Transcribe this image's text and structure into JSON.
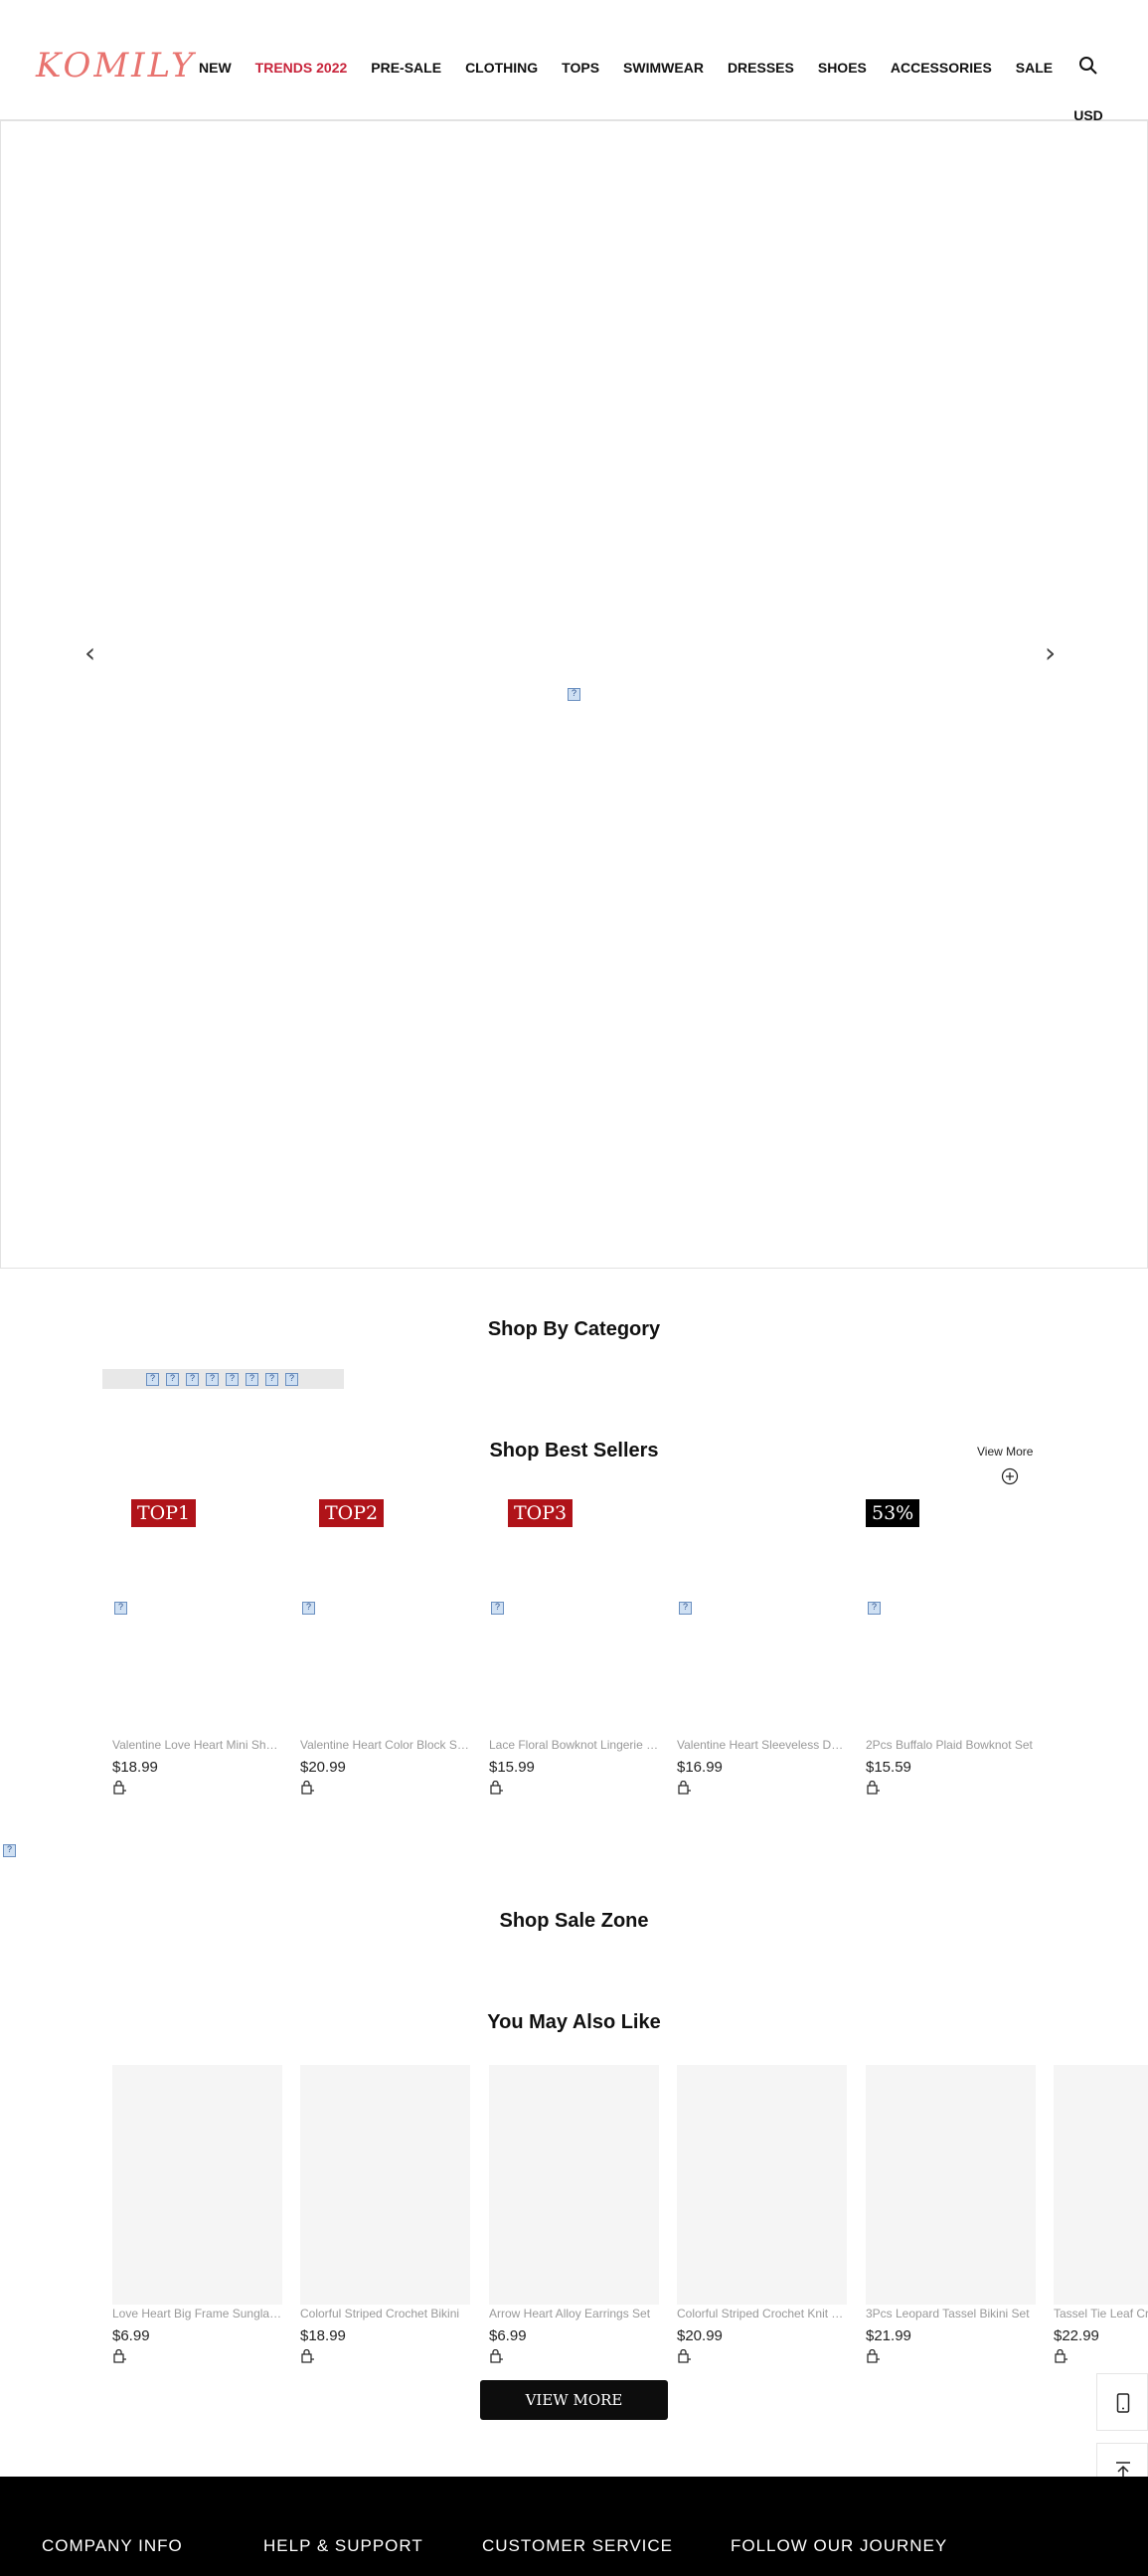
{
  "header": {
    "logo": "KOMILY",
    "nav": [
      "NEW",
      "TRENDS 2022",
      "PRE-SALE",
      "CLOTHING",
      "TOPS",
      "SWIMWEAR",
      "DRESSES",
      "SHOES",
      "ACCESSORIES",
      "SALE"
    ],
    "currency": "USD",
    "icons": [
      "search-icon",
      "headset-icon",
      "account-icon",
      "gift-icon",
      "bag-icon"
    ]
  },
  "sections": {
    "shop_by_category": "Shop By Category",
    "best_sellers": "Shop Best Sellers",
    "view_more_link": "View More",
    "sale_zone": "Shop Sale Zone",
    "you_may_also_like": "You May Also Like",
    "view_more_button": "VIEW MORE"
  },
  "best_sellers": [
    {
      "badge": "TOP1",
      "name": "Valentine Love Heart Mini Shoulder Bag",
      "price": "$18.99"
    },
    {
      "badge": "TOP2",
      "name": "Valentine Heart Color Block Sweater",
      "price": "$20.99"
    },
    {
      "badge": "TOP3",
      "name": "Lace Floral Bowknot Lingerie Set",
      "price": "$15.99"
    },
    {
      "badge": "",
      "name": "Valentine Heart Sleeveless Dress",
      "price": "$16.99"
    },
    {
      "badge": "53%",
      "name": "2Pcs Buffalo Plaid Bowknot Set",
      "price": "$15.59"
    }
  ],
  "you_may_also_like": [
    {
      "name": "Love Heart Big Frame Sunglasses",
      "price": "$6.99"
    },
    {
      "name": "Colorful Striped Crochet Bikini",
      "price": "$18.99"
    },
    {
      "name": "Arrow Heart Alloy Earrings Set",
      "price": "$6.99"
    },
    {
      "name": "Colorful Striped Crochet Knit Top",
      "price": "$20.99"
    },
    {
      "name": "3Pcs Leopard Tassel Bikini Set",
      "price": "$21.99"
    },
    {
      "name": "Tassel Tie Leaf Crop Top",
      "price": "$22.99"
    }
  ],
  "footer": {
    "columns": [
      "COMPANY INFO",
      "HELP & SUPPORT",
      "CUSTOMER SERVICE",
      "FOLLOW OUR JOURNEY"
    ]
  },
  "colors": {
    "brand": "#e8736f",
    "trends": "#c8243b",
    "badge_top": "#b01319",
    "badge_discount": "#000000"
  }
}
